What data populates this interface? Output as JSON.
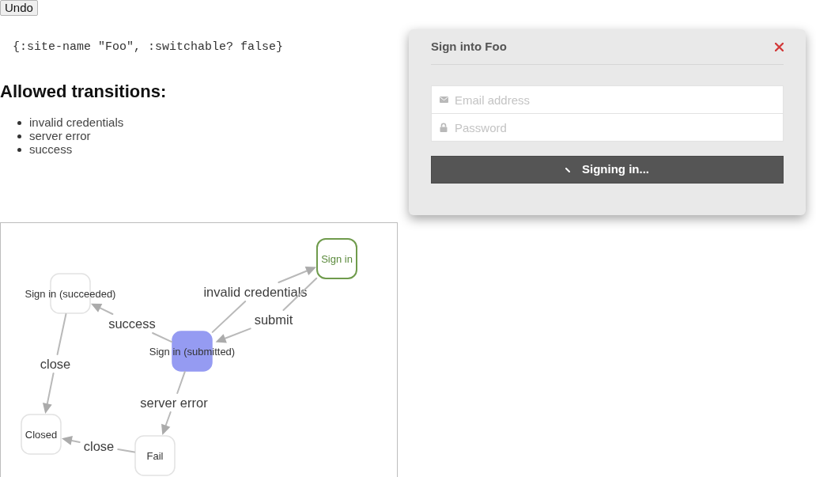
{
  "undo_button": "Undo",
  "state_code": "{:site-name \"Foo\", :switchable? false}",
  "transitions": {
    "heading": "Allowed transitions:",
    "items": [
      "invalid credentials",
      "server error",
      "success"
    ]
  },
  "state_diagram": {
    "nodes": [
      {
        "label": "Sign in",
        "kind": "start",
        "selected": false
      },
      {
        "label": "Sign in (succeeded)",
        "kind": "state",
        "selected": false
      },
      {
        "label": "Sign in (submitted)",
        "kind": "state",
        "selected": true
      },
      {
        "label": "Closed",
        "kind": "state",
        "selected": false
      },
      {
        "label": "Fail",
        "kind": "state",
        "selected": false
      }
    ],
    "edges": [
      {
        "label": "invalid credentials"
      },
      {
        "label": "submit"
      },
      {
        "label": "success"
      },
      {
        "label": "close"
      },
      {
        "label": "server error"
      },
      {
        "label": "close"
      }
    ]
  },
  "dialog": {
    "title": "Sign into Foo",
    "fields": [
      {
        "kind": "email",
        "placeholder": "Email address"
      },
      {
        "kind": "password",
        "placeholder": "Password"
      }
    ],
    "submit_button": {
      "label": "Signing in...",
      "loading": true
    }
  }
}
